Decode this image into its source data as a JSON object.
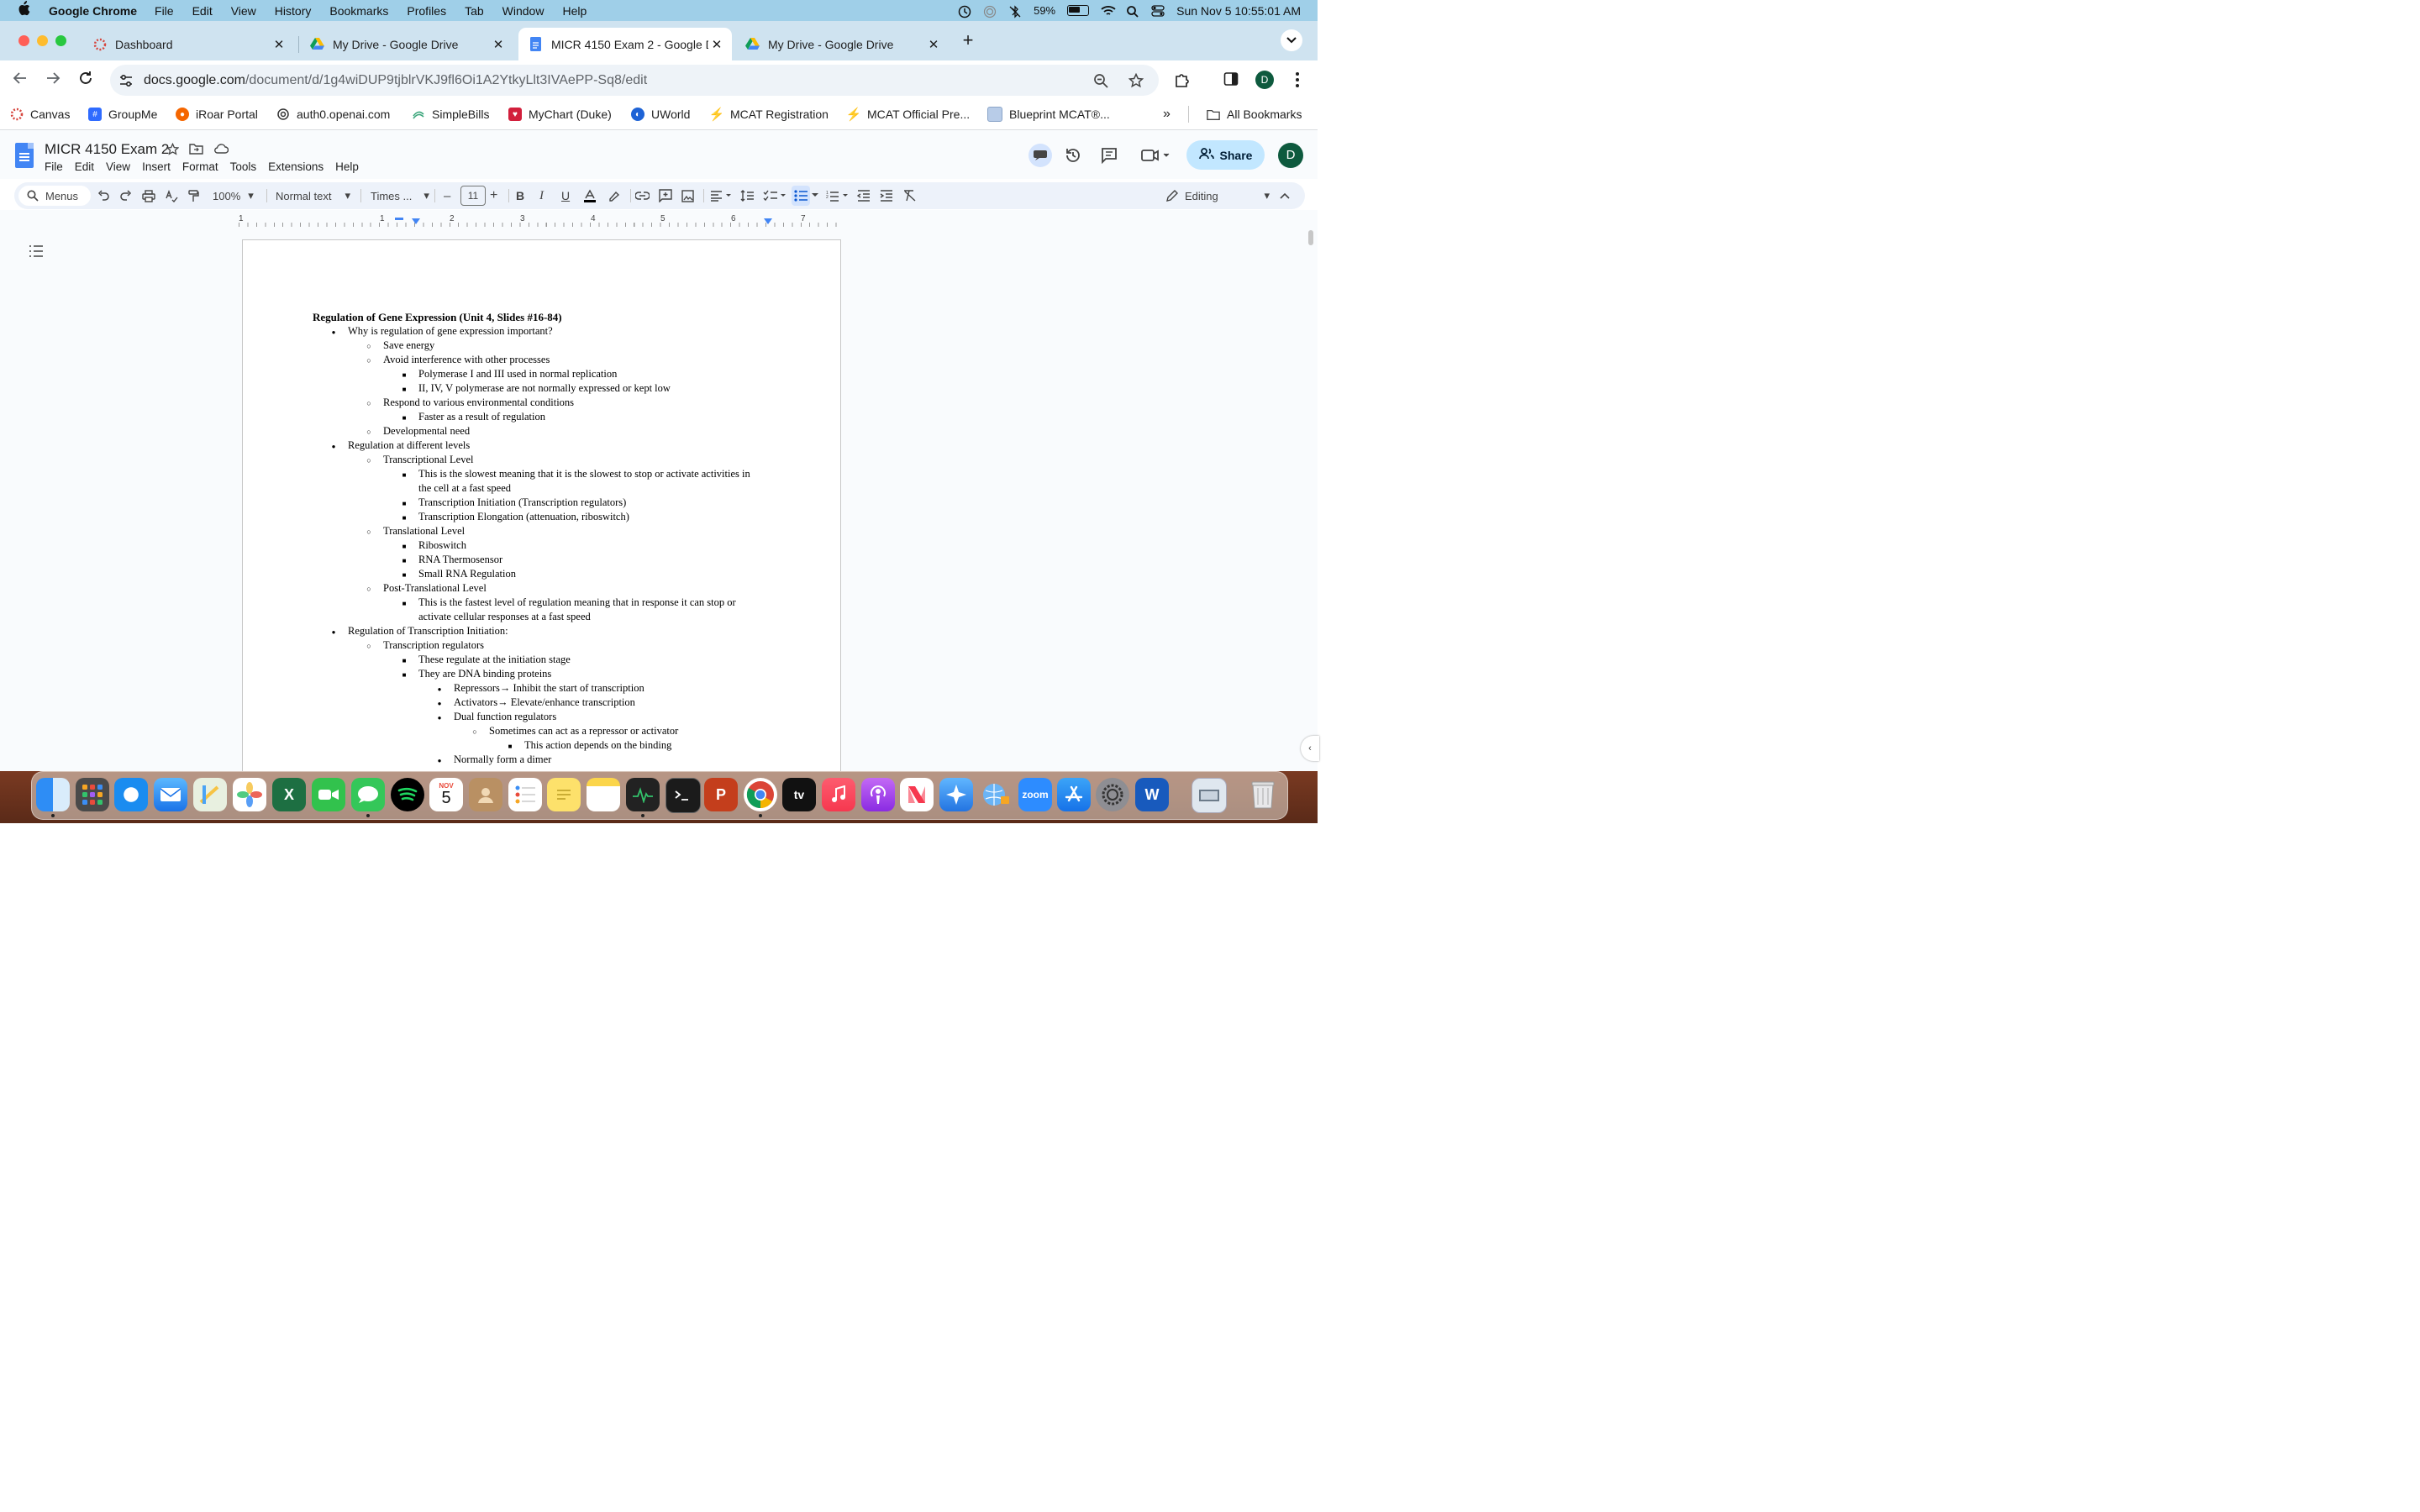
{
  "menubar": {
    "app": "Google Chrome",
    "items": [
      "File",
      "Edit",
      "View",
      "History",
      "Bookmarks",
      "Profiles",
      "Tab",
      "Window",
      "Help"
    ],
    "battery": "59%",
    "datetime": "Sun Nov 5  10:55:01 AM"
  },
  "tabs": [
    {
      "title": "Dashboard",
      "close": "✕"
    },
    {
      "title": "My Drive - Google Drive",
      "close": "✕"
    },
    {
      "title": "MICR 4150 Exam 2 - Google D",
      "close": "✕"
    },
    {
      "title": "My Drive - Google Drive",
      "close": "✕"
    }
  ],
  "newtab": "+",
  "address": {
    "domain": "docs.google.com",
    "path": "/document/d/1g4wiDUP9tjblrVKJ9fl6Oi1A2YtkyLlt3IVAePP-Sq8/edit"
  },
  "profile_initial": "D",
  "bookmarks": [
    "Canvas",
    "GroupMe",
    "iRoar Portal",
    "auth0.openai.com",
    "SimpleBills",
    "MyChart (Duke)",
    "UWorld",
    "MCAT Registration",
    "MCAT Official Pre...",
    "Blueprint MCAT®...",
    "All Bookmarks"
  ],
  "bookmarks_more": "»",
  "doc": {
    "title": "MICR 4150 Exam 2",
    "menu": [
      "File",
      "Edit",
      "View",
      "Insert",
      "Format",
      "Tools",
      "Extensions",
      "Help"
    ],
    "share": "Share",
    "avatar": "D"
  },
  "doctoolbar": {
    "menus": "Menus",
    "zoom": "100%",
    "style": "Normal text",
    "font": "Times ...",
    "size": "11",
    "editing": "Editing"
  },
  "ruler": [
    "1",
    "1",
    "2",
    "3",
    "4",
    "5",
    "6",
    "7"
  ],
  "content": {
    "heading": "Regulation of Gene Expression (Unit 4, Slides #16-84)",
    "lines": [
      "Why is regulation of gene expression important?",
      "Save energy",
      "Avoid interference with other processes",
      "Polymerase I and III used in normal replication",
      "II, IV, V polymerase are not normally expressed or kept low",
      "Respond to various environmental conditions",
      "Faster as a result of regulation",
      "Developmental need",
      "Regulation at different levels",
      "Transcriptional Level",
      "This is the slowest meaning that it is the slowest to stop or activate activities in",
      "the cell at a fast speed",
      "Transcription Initiation (Transcription regulators)",
      "Transcription Elongation (attenuation, riboswitch)",
      "Translational Level",
      "Riboswitch",
      "RNA Thermosensor",
      "Small RNA Regulation",
      "Post-Translational Level",
      "This is the fastest level of regulation meaning that in response it can stop or",
      "activate cellular responses at a fast speed",
      "Regulation of Transcription Initiation:",
      "Transcription regulators",
      "These regulate at the initiation stage",
      "They are DNA binding proteins",
      "Repressors→ Inhibit the start of transcription",
      "Activators→ Elevate/enhance transcription",
      "Dual function regulators",
      "Sometimes can act as a repressor or activator",
      "This action depends on the binding",
      "Normally form a dimer"
    ]
  },
  "dock": {
    "calendar_month": "NOV",
    "calendar_day": "5",
    "zoom_label": "zoom",
    "tv_label": "tv"
  }
}
